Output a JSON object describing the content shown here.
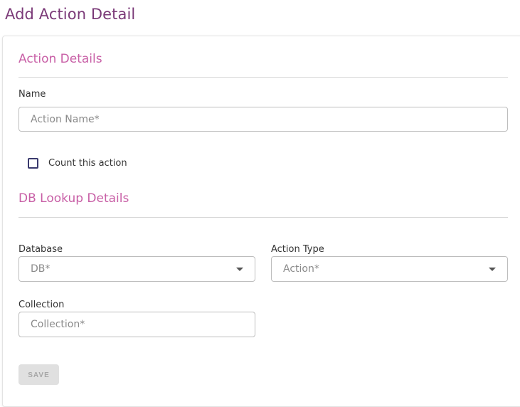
{
  "page": {
    "title": "Add Action Detail"
  },
  "action_details": {
    "section_title": "Action Details",
    "name_label": "Name",
    "name_placeholder": "Action Name*",
    "count_checkbox_label": "Count this action",
    "count_checked": false
  },
  "db_lookup": {
    "section_title": "DB Lookup Details",
    "database_label": "Database",
    "database_placeholder": "DB*",
    "action_type_label": "Action Type",
    "action_type_placeholder": "Action*",
    "collection_label": "Collection",
    "collection_placeholder": "Collection*"
  },
  "actions": {
    "save_label": "SAVE",
    "save_enabled": false
  },
  "colors": {
    "title": "#7b3a78",
    "section_title": "#c85fa6",
    "checkbox_border": "#3a3a6e"
  },
  "icons": {
    "select_caret": "caret-down-icon"
  }
}
